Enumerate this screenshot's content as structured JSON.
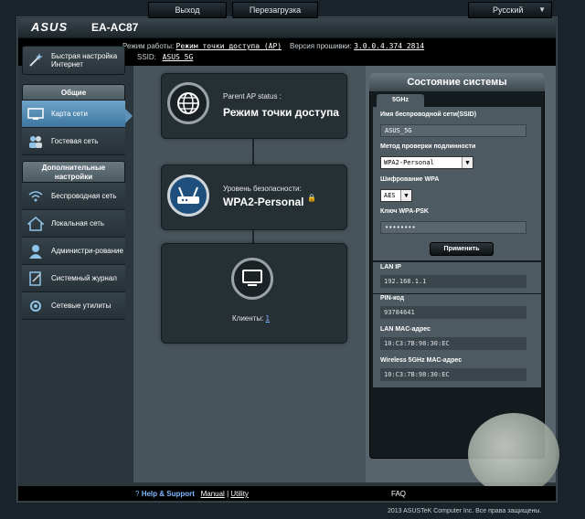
{
  "header": {
    "brand": "ASUS",
    "model": "EA-AC87",
    "logout_label": "Выход",
    "reboot_label": "Перезагрузка",
    "language": "Русский"
  },
  "info": {
    "mode_label": "Режим работы:",
    "mode_value": "Режим точки доступа (AP)",
    "firmware_label": "Версия прошивки:",
    "firmware_value": "3.0.0.4.374_2814",
    "ssid_label": "SSID:",
    "ssid_value": "ASUS_5G"
  },
  "sidebar": {
    "quick_setup": "Быстрая настройка Интернет",
    "general_header": "Общие",
    "items_general": [
      {
        "label": "Карта сети",
        "icon": "network-map-icon"
      },
      {
        "label": "Гостевая сеть",
        "icon": "guest-network-icon"
      }
    ],
    "advanced_header": "Дополнительные настройки",
    "items_advanced": [
      {
        "label": "Беспроводная сеть",
        "icon": "wireless-icon"
      },
      {
        "label": "Локальная сеть",
        "icon": "lan-icon"
      },
      {
        "label": "Администри-рование",
        "icon": "admin-icon"
      },
      {
        "label": "Системный журнал",
        "icon": "log-icon"
      },
      {
        "label": "Сетевые утилиты",
        "icon": "tools-icon"
      }
    ]
  },
  "map": {
    "parent_ap_label": "Parent AP status :",
    "parent_ap_value": "Режим точки доступа",
    "security_label": "Уровень безопасности:",
    "security_value": "WPA2-Personal",
    "clients_label": "Клиенты:",
    "clients_count": "1"
  },
  "status": {
    "title": "Состояние системы",
    "tab": "5GHz",
    "ssid_label": "Имя беспроводной сети(SSID)",
    "ssid_value": "ASUS_5G",
    "auth_label": "Метод проверки подлинности",
    "auth_value": "WPA2-Personal",
    "enc_label": "Шифрование WPA",
    "enc_value": "AES",
    "key_label": "Ключ WPA-PSK",
    "key_value": "••••••••",
    "apply_label": "Применить",
    "lan_ip_label": "LAN IP",
    "lan_ip_value": "192.168.1.1",
    "pin_label": "PIN-код",
    "pin_value": "93784641",
    "lan_mac_label": "LAN MAC-адрес",
    "lan_mac_value": "10:C3:7B:98:30:EC",
    "wl_mac_label": "Wireless 5GHz MAC-адрес",
    "wl_mac_value": "10:C3:7B:98:30:EC"
  },
  "footer": {
    "help": "Help & Support",
    "manual": "Manual",
    "sep": "|",
    "utility": "Utility",
    "faq": "FAQ",
    "copyright": "2013  ASUSTeK Computer Inc. Все права защищены."
  },
  "colors": {
    "accent": "#5e93b9",
    "panel": "#141b1f",
    "main_bg": "#57646b"
  }
}
